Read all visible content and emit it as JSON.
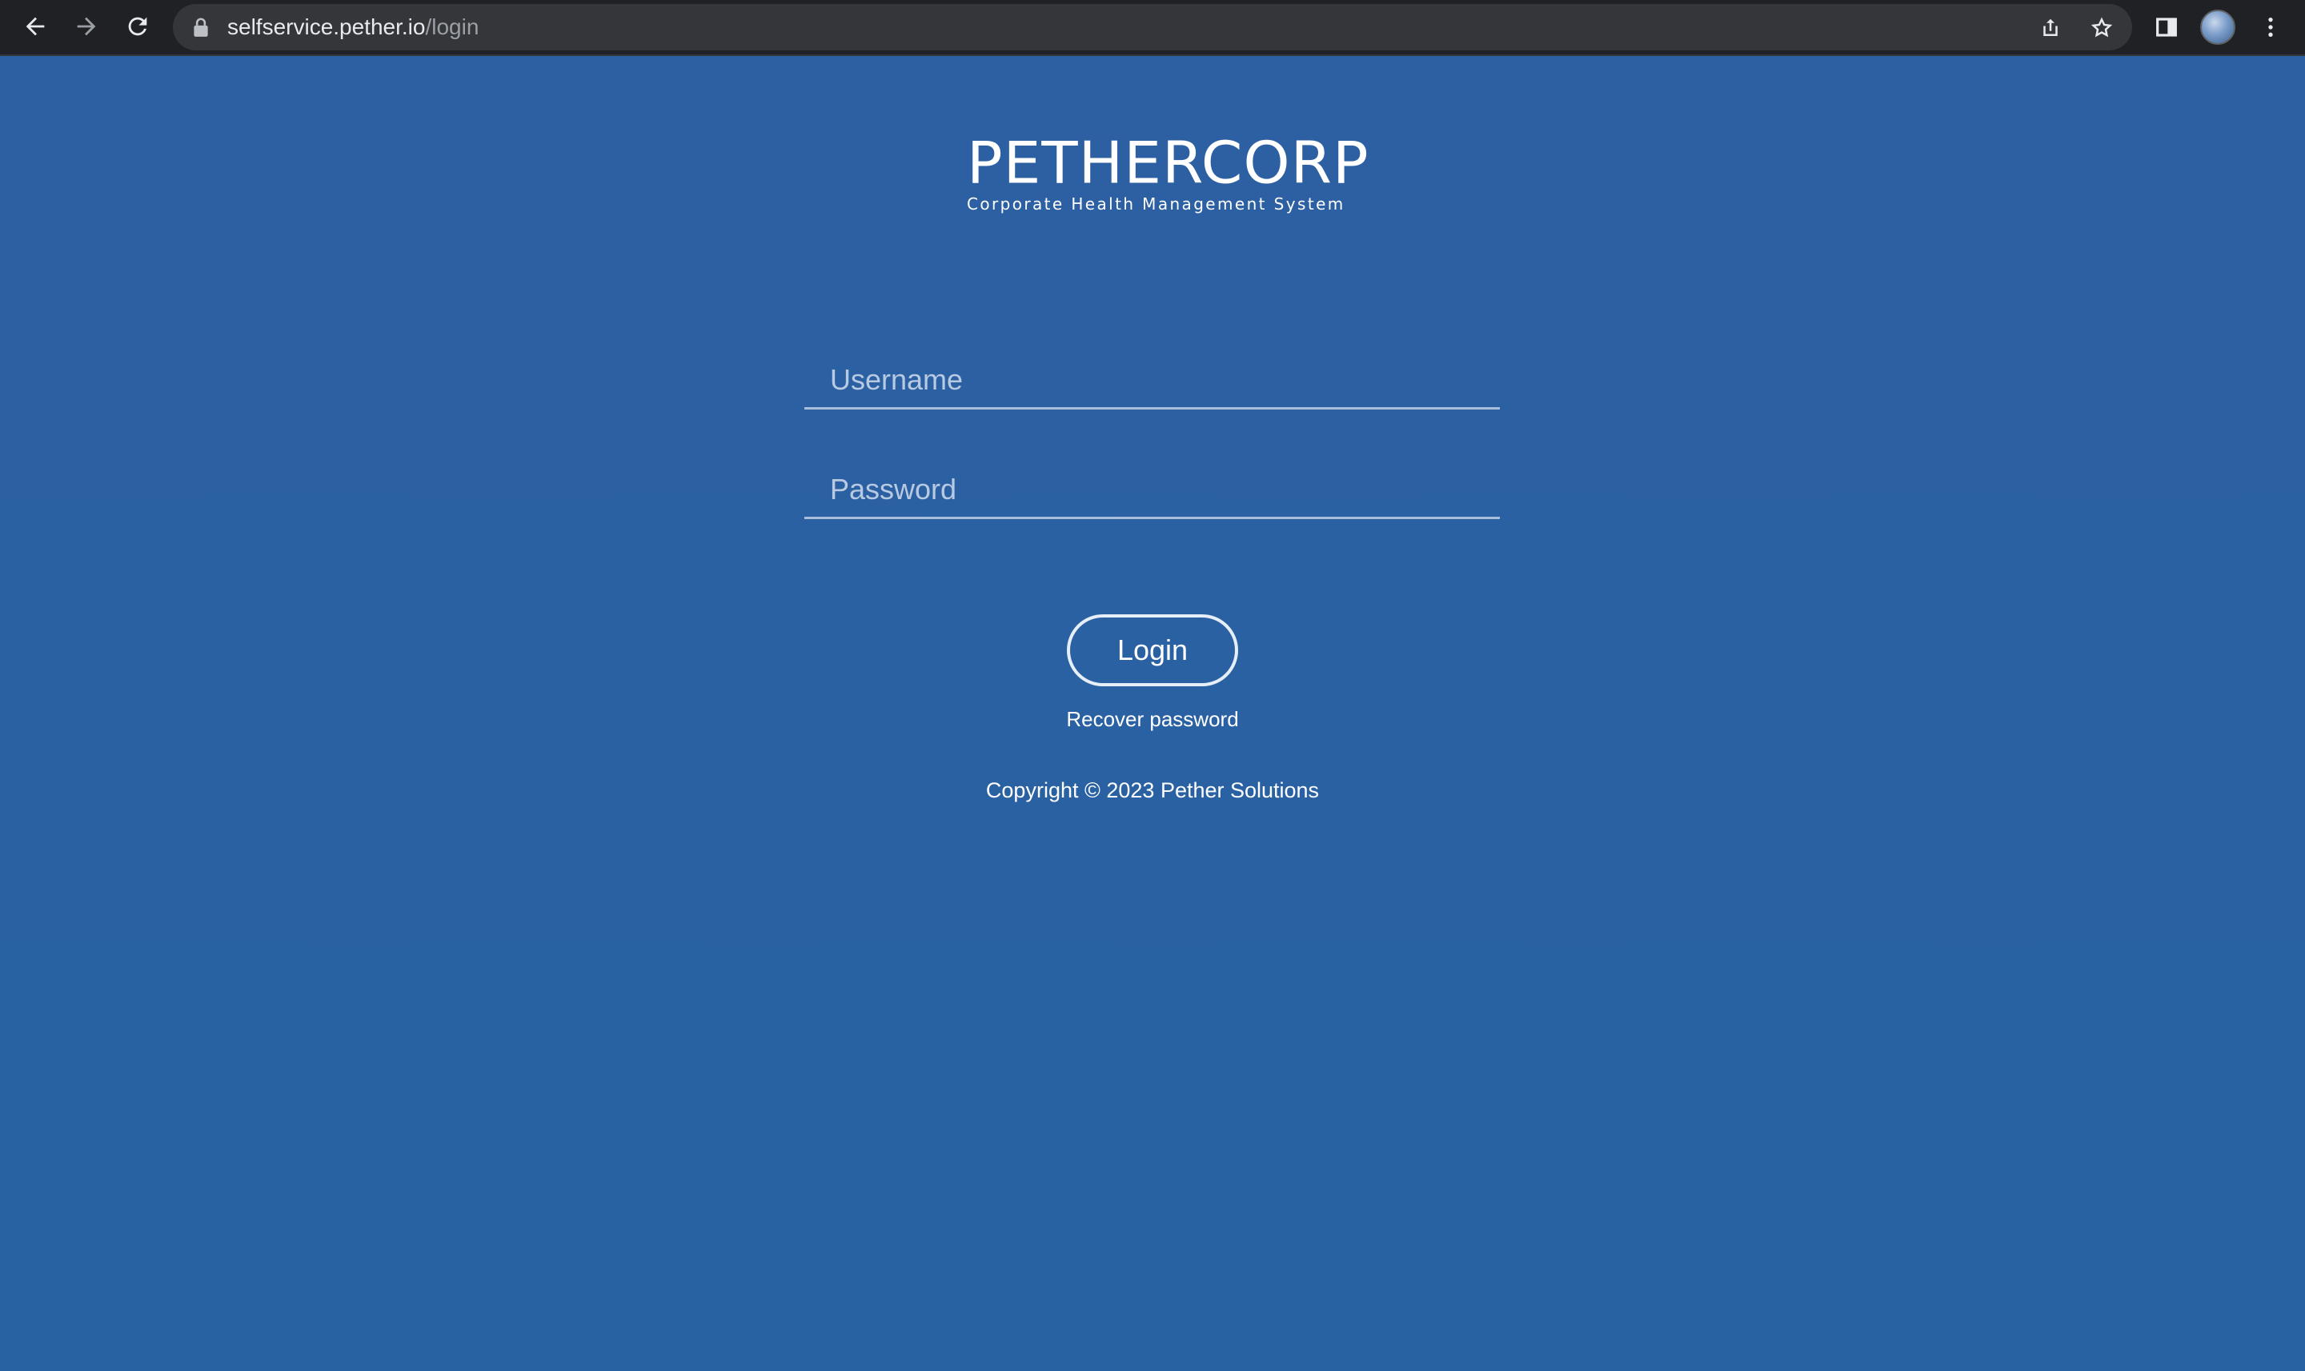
{
  "browser": {
    "url_host": "selfservice.pether.io",
    "url_path": "/login"
  },
  "logo": {
    "wordmark": "PETHERCORP",
    "tagline": "Corporate Health Management  System"
  },
  "form": {
    "username_placeholder": "Username",
    "password_placeholder": "Password",
    "login_label": "Login",
    "recover_label": "Recover password"
  },
  "footer": {
    "copyright": "Copyright © 2023 Pether Solutions"
  },
  "colors": {
    "page_background": "#2d61a3",
    "chrome_background": "#202124",
    "text": "#ffffff"
  }
}
